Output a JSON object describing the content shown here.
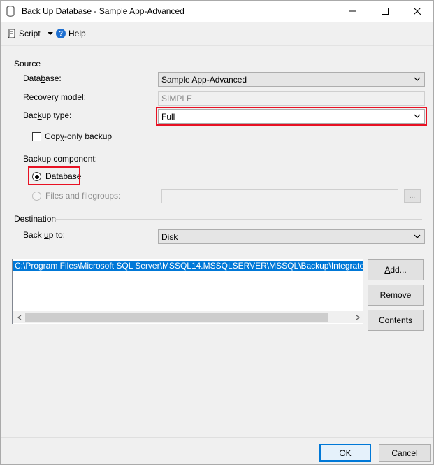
{
  "window": {
    "title": "Back Up Database - Sample App-Advanced",
    "icon": "database-icon",
    "caption_buttons": [
      "minimize-icon",
      "maximize-icon",
      "close-icon"
    ]
  },
  "toolbar": {
    "script_label": "Script",
    "help_label": "Help"
  },
  "source": {
    "header": "Source",
    "database_label_pre": "Data",
    "database_label_key": "b",
    "database_label_post": "ase:",
    "database_value": "Sample App-Advanced",
    "recovery_label_pre": "Recovery ",
    "recovery_label_key": "m",
    "recovery_label_post": "odel:",
    "recovery_value": "SIMPLE",
    "backup_type_label_pre": "Bac",
    "backup_type_label_key": "k",
    "backup_type_label_post": "up type:",
    "backup_type_value": "Full",
    "copy_only_label_pre": "Cop",
    "copy_only_label_key": "y",
    "copy_only_label_post": "-only backup",
    "copy_only_checked": false,
    "component_label": "Backup component:",
    "component_database_pre": "Data",
    "component_database_key": "b",
    "component_database_post": "ase",
    "component_files_label": "Files and filegroups:",
    "browse_label": "..."
  },
  "destination": {
    "header": "Destination",
    "backup_to_label_pre": "Back ",
    "backup_to_label_key": "u",
    "backup_to_label_post": "p to:",
    "backup_to_value": "Disk",
    "paths": [
      "C:\\Program Files\\Microsoft SQL Server\\MSSQL14.MSSQLSERVER\\MSSQL\\Backup\\Integrated_Financials"
    ],
    "add_key": "A",
    "add_post": "dd...",
    "remove_key": "R",
    "remove_post": "emove",
    "contents_key": "C",
    "contents_post": "ontents"
  },
  "footer": {
    "ok_label": "OK",
    "cancel_label": "Cancel"
  },
  "colors": {
    "highlight_outline": "#e81123",
    "selection": "#0078d7",
    "help_icon": "#1e6fd0"
  }
}
